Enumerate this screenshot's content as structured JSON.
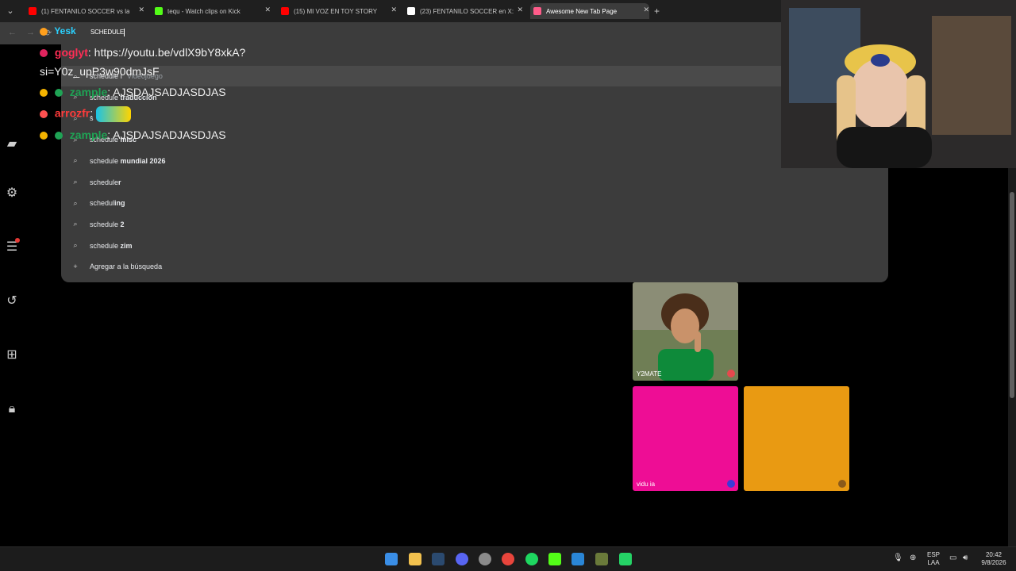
{
  "tabs": [
    {
      "title": "(1) FENTANILO SOCCER vs la",
      "favicon_color": "#ff0000",
      "active": false
    },
    {
      "title": "tequ - Watch clips on Kick",
      "favicon_color": "#53fc18",
      "active": false
    },
    {
      "title": "(15) MI VOZ EN TOY STORY",
      "favicon_color": "#ff0000",
      "active": false
    },
    {
      "title": "(23) FENTANILO SOCCER en X:",
      "favicon_color": "#ffffff",
      "active": false
    },
    {
      "title": "Awesome New Tab Page",
      "favicon_color": "#ff5c8a",
      "active": true
    }
  ],
  "omnibox": {
    "value": "SCHEDULE"
  },
  "suggestions": [
    {
      "prefix": "schedule I",
      "bold": "",
      "sub": "Videojuego"
    },
    {
      "prefix": "schedule ",
      "bold": "traduccion",
      "sub": ""
    },
    {
      "prefix": "s",
      "bold": "",
      "sub": ""
    },
    {
      "prefix": "schedule ",
      "bold": "misc",
      "sub": ""
    },
    {
      "prefix": "schedule ",
      "bold": "mundial 2026",
      "sub": ""
    },
    {
      "prefix": "schedule",
      "bold": "r",
      "sub": ""
    },
    {
      "prefix": "schedul",
      "bold": "ing",
      "sub": ""
    },
    {
      "prefix": "schedule ",
      "bold": "2",
      "sub": ""
    },
    {
      "prefix": "schedule ",
      "bold": "zim",
      "sub": ""
    }
  ],
  "add_search_label": "Agregar a la búsqueda",
  "chat": {
    "stream_label": "Yesk",
    "messages": [
      {
        "user": "goglyt",
        "user_color": "#ff2d55",
        "text": ": https://youtu.be/vdlX9bY8xkA?",
        "cont": "si=Y0z_upP3w90dmJsF"
      },
      {
        "user": "zample",
        "user_color": "#1fa355",
        "text": ": AJSDAJSADJASDJAS",
        "cont": ""
      },
      {
        "user": "arrozfr",
        "user_color": "#ff3b3b",
        "text": ":",
        "cont": ""
      },
      {
        "user": "zample",
        "user_color": "#1fa355",
        "text": ": AJSDAJSADJASDJAS",
        "cont": ""
      }
    ]
  },
  "tiles": [
    {
      "label": "Y2MATE",
      "color": "#5c6d3a"
    },
    {
      "label": "vidu ia",
      "color": "#ee0d95"
    },
    {
      "label": "",
      "color": "#e99a12"
    }
  ],
  "taskbar": {
    "lang": "ESP",
    "region": "LAA",
    "time": "20:42",
    "date": "9/8/2026"
  }
}
